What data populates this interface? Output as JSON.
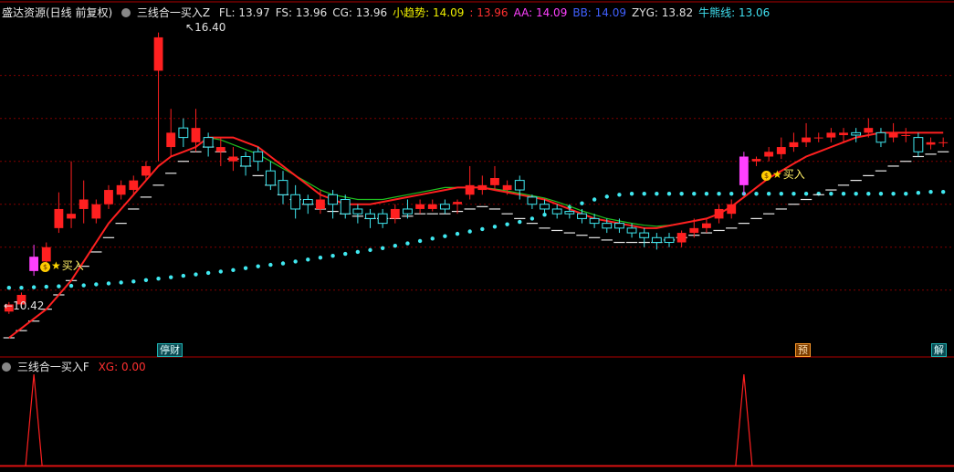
{
  "upper": {
    "title_stock": "盛达资源(日线 前复权)",
    "indicator_name": "三线合一买入Z",
    "legend": [
      {
        "label": "FL: 13.97",
        "color": "#e0e0e0"
      },
      {
        "label": "FS: 13.96",
        "color": "#e0e0e0"
      },
      {
        "label": "CG: 13.96",
        "color": "#e0e0e0"
      },
      {
        "label": "小趋势: 14.09",
        "color": "#f0f000"
      },
      {
        "label": ": 13.96",
        "color": "#ff3030"
      },
      {
        "label": "AA: 14.09",
        "color": "#ff40ff"
      },
      {
        "label": "BB: 14.09",
        "color": "#4060ff"
      },
      {
        "label": "ZYG: 13.82",
        "color": "#e0e0e0"
      },
      {
        "label": "牛熊线: 13.06",
        "color": "#40e0f0"
      }
    ],
    "max_label": "16.40",
    "min_label": "10.42",
    "buy_label": "买入",
    "bottom_tags": [
      {
        "label": "停财",
        "style": "teal"
      },
      {
        "label": "预",
        "style": "orange"
      },
      {
        "label": "解",
        "style": "teal"
      }
    ]
  },
  "lower": {
    "indicator_name": "三线合一买入F",
    "xg_label": "XG: 0.00"
  },
  "colors": {
    "up": "#ff2020",
    "down": "#40e8f0",
    "buy_candle": "#ff40ff",
    "red_line": "#ff2020",
    "green_line": "#20c020",
    "dots": "#40e8f0",
    "steps": "#e8e8e8",
    "grid": "#800000"
  },
  "chart_data": {
    "type": "candlestick",
    "ylim": [
      10.0,
      16.7
    ],
    "price_grid": [
      15.5,
      14.6,
      13.7,
      12.8,
      11.9,
      11.0
    ],
    "candles": [
      [
        10.55,
        10.7,
        10.5,
        10.75
      ],
      [
        10.7,
        10.9,
        10.65,
        10.95
      ],
      [
        11.4,
        11.7,
        11.3,
        11.95
      ],
      [
        11.6,
        11.9,
        11.55,
        12.0
      ],
      [
        12.3,
        12.7,
        12.2,
        13.05
      ],
      [
        12.5,
        12.6,
        12.3,
        13.7
      ],
      [
        12.7,
        12.9,
        12.4,
        13.3
      ],
      [
        12.5,
        12.8,
        12.4,
        12.9
      ],
      [
        12.8,
        13.1,
        12.7,
        13.2
      ],
      [
        13.0,
        13.2,
        12.9,
        13.3
      ],
      [
        13.1,
        13.3,
        13.0,
        13.4
      ],
      [
        13.4,
        13.6,
        13.3,
        13.7
      ],
      [
        15.6,
        16.3,
        13.7,
        16.4
      ],
      [
        14.0,
        14.3,
        13.8,
        14.8
      ],
      [
        14.4,
        14.2,
        14.0,
        14.6
      ],
      [
        14.1,
        14.4,
        13.9,
        14.8
      ],
      [
        14.2,
        14.0,
        13.8,
        14.3
      ],
      [
        13.9,
        14.0,
        13.6,
        14.2
      ],
      [
        13.7,
        13.8,
        13.5,
        14.0
      ],
      [
        13.8,
        13.6,
        13.4,
        13.9
      ],
      [
        13.9,
        13.7,
        13.5,
        14.0
      ],
      [
        13.5,
        13.2,
        13.1,
        13.7
      ],
      [
        13.3,
        13.0,
        12.8,
        13.5
      ],
      [
        13.0,
        12.7,
        12.5,
        13.2
      ],
      [
        12.9,
        12.8,
        12.6,
        13.0
      ],
      [
        12.7,
        12.9,
        12.6,
        13.1
      ],
      [
        13.0,
        12.8,
        12.5,
        13.1
      ],
      [
        12.9,
        12.6,
        12.5,
        13.0
      ],
      [
        12.7,
        12.6,
        12.4,
        12.8
      ],
      [
        12.6,
        12.5,
        12.3,
        12.7
      ],
      [
        12.6,
        12.4,
        12.3,
        12.7
      ],
      [
        12.5,
        12.7,
        12.4,
        12.8
      ],
      [
        12.7,
        12.6,
        12.5,
        12.9
      ],
      [
        12.7,
        12.8,
        12.6,
        12.9
      ],
      [
        12.7,
        12.8,
        12.65,
        12.9
      ],
      [
        12.8,
        12.7,
        12.6,
        12.9
      ],
      [
        12.8,
        12.85,
        12.6,
        12.9
      ],
      [
        13.0,
        13.2,
        12.9,
        13.6
      ],
      [
        13.1,
        13.2,
        13.0,
        13.4
      ],
      [
        13.2,
        13.35,
        13.1,
        13.6
      ],
      [
        13.1,
        13.2,
        13.0,
        13.3
      ],
      [
        13.3,
        13.1,
        12.9,
        13.4
      ],
      [
        12.95,
        12.8,
        12.7,
        13.0
      ],
      [
        12.8,
        12.7,
        12.6,
        12.9
      ],
      [
        12.7,
        12.6,
        12.5,
        12.8
      ],
      [
        12.65,
        12.6,
        12.5,
        12.8
      ],
      [
        12.6,
        12.5,
        12.4,
        12.7
      ],
      [
        12.5,
        12.4,
        12.3,
        12.6
      ],
      [
        12.4,
        12.3,
        12.2,
        12.5
      ],
      [
        12.4,
        12.3,
        12.2,
        12.5
      ],
      [
        12.3,
        12.2,
        12.1,
        12.4
      ],
      [
        12.2,
        12.1,
        11.9,
        12.3
      ],
      [
        12.1,
        12.0,
        11.85,
        12.2
      ],
      [
        12.1,
        12.0,
        11.9,
        12.2
      ],
      [
        12.0,
        12.2,
        11.9,
        12.25
      ],
      [
        12.2,
        12.3,
        12.1,
        12.5
      ],
      [
        12.3,
        12.4,
        12.2,
        12.5
      ],
      [
        12.5,
        12.7,
        12.4,
        12.8
      ],
      [
        12.6,
        12.8,
        12.5,
        12.9
      ],
      [
        13.2,
        13.8,
        13.0,
        13.9
      ],
      [
        13.7,
        13.75,
        13.6,
        13.8
      ],
      [
        13.8,
        13.9,
        13.7,
        14.0
      ],
      [
        13.85,
        14.0,
        13.75,
        14.2
      ],
      [
        14.0,
        14.1,
        13.9,
        14.3
      ],
      [
        14.1,
        14.2,
        14.0,
        14.5
      ],
      [
        14.2,
        14.2,
        14.1,
        14.3
      ],
      [
        14.2,
        14.3,
        14.1,
        14.4
      ],
      [
        14.25,
        14.3,
        14.1,
        14.4
      ],
      [
        14.3,
        14.25,
        14.1,
        14.4
      ],
      [
        14.3,
        14.4,
        14.2,
        14.6
      ],
      [
        14.3,
        14.1,
        14.0,
        14.4
      ],
      [
        14.2,
        14.3,
        14.1,
        14.5
      ],
      [
        14.25,
        14.25,
        14.1,
        14.4
      ],
      [
        14.2,
        13.9,
        13.8,
        14.3
      ],
      [
        14.05,
        14.1,
        13.95,
        14.2
      ],
      [
        14.1,
        14.1,
        14.0,
        14.2
      ]
    ],
    "buy_bar_indices": [
      2,
      59
    ],
    "buy_bar_colors": [
      "#ff40ff",
      "#ff40ff"
    ],
    "xg_spike_indices": [
      2,
      59
    ],
    "red_line": [
      10.0,
      10.2,
      10.4,
      10.6,
      10.9,
      11.2,
      11.6,
      12.0,
      12.4,
      12.7,
      13.0,
      13.3,
      13.6,
      13.8,
      13.9,
      14.0,
      14.2,
      14.2,
      14.2,
      14.1,
      14.0,
      13.8,
      13.6,
      13.4,
      13.2,
      13.0,
      12.9,
      12.8,
      12.8,
      12.8,
      12.85,
      12.9,
      12.95,
      13.0,
      13.05,
      13.1,
      13.15,
      13.15,
      13.15,
      13.1,
      13.05,
      13.0,
      12.95,
      12.9,
      12.8,
      12.7,
      12.6,
      12.5,
      12.45,
      12.4,
      12.35,
      12.3,
      12.3,
      12.35,
      12.4,
      12.45,
      12.5,
      12.6,
      12.75,
      12.95,
      13.15,
      13.35,
      13.5,
      13.65,
      13.8,
      13.9,
      14.0,
      14.1,
      14.2,
      14.25,
      14.3,
      14.3,
      14.3,
      14.3,
      14.3,
      14.3
    ],
    "green_line": [
      null,
      null,
      null,
      null,
      null,
      null,
      null,
      null,
      null,
      null,
      null,
      null,
      null,
      null,
      null,
      null,
      14.2,
      14.15,
      14.05,
      13.95,
      13.85,
      13.7,
      13.55,
      13.4,
      13.25,
      13.1,
      13.0,
      12.95,
      12.9,
      12.9,
      12.9,
      12.95,
      13.0,
      13.05,
      13.1,
      13.15,
      13.15,
      13.15,
      13.15,
      13.12,
      13.08,
      13.03,
      12.98,
      12.93,
      12.85,
      12.76,
      12.66,
      12.58,
      12.5,
      12.45,
      12.4,
      12.36,
      12.34,
      12.36,
      12.4,
      null,
      null,
      null,
      null,
      null,
      null,
      null,
      null,
      null,
      null,
      null,
      null,
      null,
      null,
      null,
      null,
      null,
      null,
      null,
      null,
      null
    ],
    "dots": [
      11.05,
      11.05,
      11.06,
      11.07,
      11.08,
      11.09,
      11.1,
      11.12,
      11.14,
      11.16,
      11.18,
      11.21,
      11.24,
      11.27,
      11.3,
      11.33,
      11.36,
      11.39,
      11.42,
      11.46,
      11.5,
      11.53,
      11.56,
      11.6,
      11.64,
      11.68,
      11.72,
      11.76,
      11.8,
      11.84,
      11.88,
      11.93,
      11.98,
      12.03,
      12.08,
      12.13,
      12.18,
      12.23,
      12.28,
      12.33,
      12.38,
      12.43,
      12.5,
      12.58,
      12.66,
      12.74,
      12.82,
      12.9,
      12.96,
      13.0,
      13.02,
      13.02,
      13.02,
      13.02,
      13.02,
      13.02,
      13.02,
      13.02,
      13.02,
      13.02,
      13.02,
      13.02,
      13.02,
      13.02,
      13.02,
      13.02,
      13.02,
      13.02,
      13.02,
      13.02,
      13.02,
      13.02,
      13.02,
      13.04,
      13.06,
      13.06
    ],
    "steps": [
      10.0,
      10.15,
      10.35,
      10.6,
      10.9,
      11.2,
      11.5,
      11.8,
      12.1,
      12.4,
      12.7,
      12.95,
      13.2,
      13.45,
      13.7,
      13.9,
      14.0,
      13.9,
      13.75,
      13.6,
      13.4,
      13.2,
      13.0,
      12.9,
      12.8,
      12.7,
      12.65,
      12.6,
      12.55,
      12.5,
      12.5,
      12.5,
      12.55,
      12.6,
      12.6,
      12.6,
      12.65,
      12.7,
      12.75,
      12.7,
      12.6,
      12.5,
      12.4,
      12.3,
      12.25,
      12.2,
      12.15,
      12.1,
      12.05,
      12.0,
      12.0,
      12.0,
      12.0,
      12.05,
      12.1,
      12.15,
      12.2,
      12.25,
      12.3,
      12.4,
      12.5,
      12.6,
      12.7,
      12.8,
      12.9,
      13.0,
      13.1,
      13.2,
      13.3,
      13.4,
      13.5,
      13.6,
      13.7,
      13.8,
      13.85,
      13.9
    ]
  }
}
